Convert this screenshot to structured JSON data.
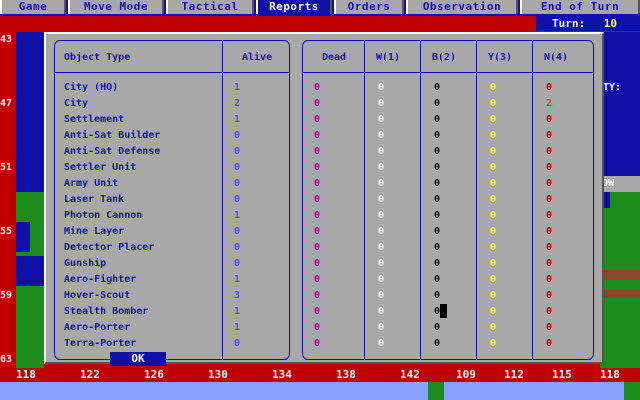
{
  "menu": {
    "items": [
      {
        "label": "Game",
        "active": false
      },
      {
        "label": "Move Mode",
        "active": false
      },
      {
        "label": "Tactical",
        "active": false
      },
      {
        "label": "Reports",
        "active": true
      },
      {
        "label": "Orders",
        "active": false
      },
      {
        "label": "Observation",
        "active": false
      },
      {
        "label": "End of Turn",
        "active": false
      }
    ]
  },
  "turn": {
    "label": "Turn:",
    "value": "10"
  },
  "map": {
    "row_labels": [
      "43",
      "47",
      "51",
      "55",
      "59",
      "63"
    ],
    "col_labels": [
      "118",
      "122",
      "126",
      "130",
      "134",
      "138",
      "142",
      "109",
      "112",
      "115",
      "118"
    ],
    "side_texts": [
      "TY:",
      "DOW"
    ]
  },
  "report": {
    "headers": {
      "object_type": "Object Type",
      "alive": "Alive",
      "dead": "Dead",
      "w": "W(1)",
      "b": "B(2)",
      "y": "Y(3)",
      "n": "N(4)"
    },
    "rows": [
      {
        "name": "City (HQ)",
        "alive": "1",
        "dead": "0",
        "w": "0",
        "b": "0",
        "y": "0",
        "n": "0"
      },
      {
        "name": "City",
        "alive": "2",
        "dead": "0",
        "w": "0",
        "b": "0",
        "y": "0",
        "n": "2"
      },
      {
        "name": "Settlement",
        "alive": "1",
        "dead": "0",
        "w": "0",
        "b": "0",
        "y": "0",
        "n": "0"
      },
      {
        "name": "Anti-Sat Builder",
        "alive": "0",
        "dead": "0",
        "w": "0",
        "b": "0",
        "y": "0",
        "n": "0"
      },
      {
        "name": "Anti-Sat Defense",
        "alive": "0",
        "dead": "0",
        "w": "0",
        "b": "0",
        "y": "0",
        "n": "0"
      },
      {
        "name": "Settler Unit",
        "alive": "0",
        "dead": "0",
        "w": "0",
        "b": "0",
        "y": "0",
        "n": "0"
      },
      {
        "name": "Army Unit",
        "alive": "0",
        "dead": "0",
        "w": "0",
        "b": "0",
        "y": "0",
        "n": "0"
      },
      {
        "name": "Laser Tank",
        "alive": "0",
        "dead": "0",
        "w": "0",
        "b": "0",
        "y": "0",
        "n": "0"
      },
      {
        "name": "Photon Cannon",
        "alive": "1",
        "dead": "0",
        "w": "0",
        "b": "0",
        "y": "0",
        "n": "0"
      },
      {
        "name": "Mine Layer",
        "alive": "0",
        "dead": "0",
        "w": "0",
        "b": "0",
        "y": "0",
        "n": "0"
      },
      {
        "name": "Detector Placer",
        "alive": "0",
        "dead": "0",
        "w": "0",
        "b": "0",
        "y": "0",
        "n": "0"
      },
      {
        "name": "Gunship",
        "alive": "0",
        "dead": "0",
        "w": "0",
        "b": "0",
        "y": "0",
        "n": "0"
      },
      {
        "name": "Aero-Fighter",
        "alive": "1",
        "dead": "0",
        "w": "0",
        "b": "0",
        "y": "0",
        "n": "0"
      },
      {
        "name": "Hover-Scout",
        "alive": "3",
        "dead": "0",
        "w": "0",
        "b": "0",
        "y": "0",
        "n": "0"
      },
      {
        "name": "Stealth Bomber",
        "alive": "1",
        "dead": "0",
        "w": "0",
        "b": "0",
        "y": "0",
        "n": "0"
      },
      {
        "name": "Aero-Porter",
        "alive": "1",
        "dead": "0",
        "w": "0",
        "b": "0",
        "y": "0",
        "n": "0"
      },
      {
        "name": "Terra-Porter",
        "alive": "0",
        "dead": "0",
        "w": "0",
        "b": "0",
        "y": "0",
        "n": "0"
      }
    ],
    "ok_label": "OK"
  }
}
